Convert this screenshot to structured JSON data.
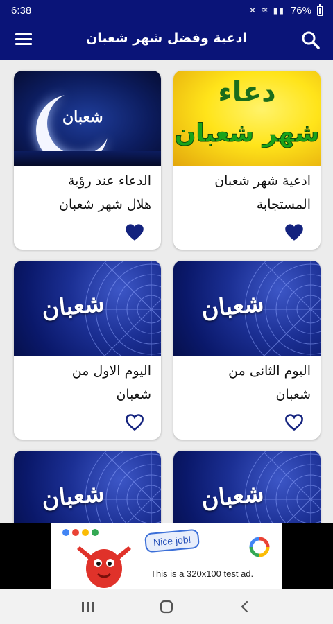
{
  "status_bar": {
    "time": "6:38",
    "battery": "76%"
  },
  "app_bar": {
    "title": "ادعية وفضل شهر شعبان"
  },
  "cards": [
    {
      "title_line1": "ادعية شهر شعبان",
      "title_line2": "المستجابة",
      "image_text_1": "دعاء",
      "image_text_2": "شهر شعبان",
      "favorite": true
    },
    {
      "title_line1": "الدعاء عند رؤية",
      "title_line2": "هلال شهر شعبان",
      "image_text_1": "شعبان",
      "favorite": true
    },
    {
      "title_line1": "اليوم الثانى من",
      "title_line2": "شعبان",
      "image_text_1": "شعبان",
      "favorite": false
    },
    {
      "title_line1": "اليوم الاول من",
      "title_line2": "شعبان",
      "image_text_1": "شعبان",
      "favorite": false
    },
    {
      "image_text_1": "شعبان"
    },
    {
      "image_text_1": "شعبان"
    }
  ],
  "ad": {
    "bubble": "Nice job!",
    "text": "This is a 320x100 test ad."
  },
  "colors": {
    "primary": "#0a1478",
    "heart": "#13227e"
  }
}
